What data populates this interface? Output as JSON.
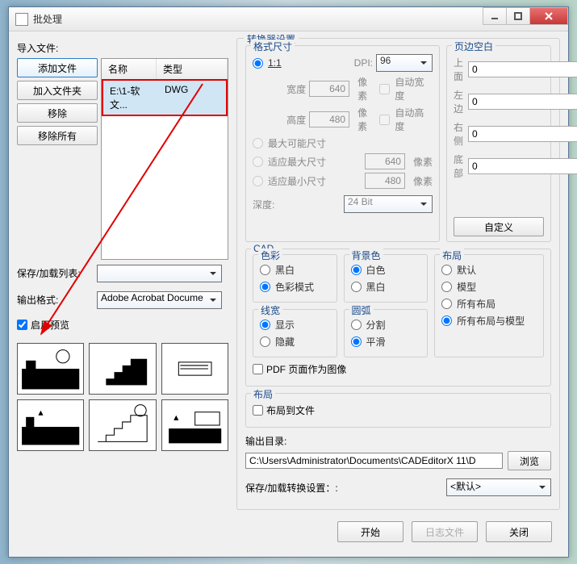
{
  "window": {
    "title": "批处理"
  },
  "left": {
    "import_label": "导入文件:",
    "buttons": {
      "add_file": "添加文件",
      "add_folder": "加入文件夹",
      "remove": "移除",
      "remove_all": "移除所有"
    },
    "table": {
      "col_name": "名称",
      "col_type": "类型",
      "rows": [
        {
          "name": "E:\\1-软文...",
          "type": "DWG"
        }
      ]
    },
    "save_list_label": "保存/加载列表:",
    "save_list_value": "",
    "output_format_label": "输出格式:",
    "output_format_value": "Adobe Acrobat Docume",
    "enable_preview": "启用预览"
  },
  "converter": {
    "title": "转换器设置",
    "format": {
      "title": "格式尺寸",
      "opt_11": "1:1",
      "dpi_label": "DPI:",
      "dpi_value": "96",
      "width_label": "宽度",
      "width_value": "640",
      "auto_width": "自动宽度",
      "height_label": "高度",
      "height_value": "480",
      "auto_height": "自动高度",
      "unit_px": "像素",
      "opt_max": "最大可能尺寸",
      "opt_fit_max": "适应最大尺寸",
      "fit_max_value": "640",
      "opt_fit_min": "适应最小尺寸",
      "fit_min_value": "480",
      "depth_label": "深度:",
      "depth_value": "24 Bit"
    },
    "margins": {
      "title": "页边空白",
      "top": "上面",
      "left": "左边",
      "right": "右侧",
      "bottom": "底部",
      "top_v": "0",
      "left_v": "0",
      "right_v": "0",
      "bottom_v": "0",
      "custom_btn": "自定义"
    },
    "cad": {
      "title": "CAD",
      "color": {
        "title": "色彩",
        "bw": "黑白",
        "mode": "色彩模式"
      },
      "bg": {
        "title": "背景色",
        "white": "白色",
        "black": "黑白"
      },
      "layout": {
        "title": "布局",
        "default": "默认",
        "model": "模型",
        "all": "所有布局",
        "all_model": "所有布局与模型"
      },
      "lw": {
        "title": "线宽",
        "show": "显示",
        "hide": "隐藏"
      },
      "arc": {
        "title": "圆弧",
        "split": "分割",
        "smooth": "平滑"
      }
    },
    "pdf_page_image": "PDF 页面作为图像",
    "layout2": {
      "title": "布局",
      "to_file": "布局到文件"
    },
    "output_dir_label": "输出目录:",
    "output_dir_value": "C:\\Users\\Administrator\\Documents\\CADEditorX 11\\D",
    "browse": "浏览",
    "save_cfg_label": "保存/加载转换设置：:",
    "save_cfg_value": "<默认>"
  },
  "footer": {
    "start": "开始",
    "log": "日志文件",
    "close": "关闭"
  }
}
